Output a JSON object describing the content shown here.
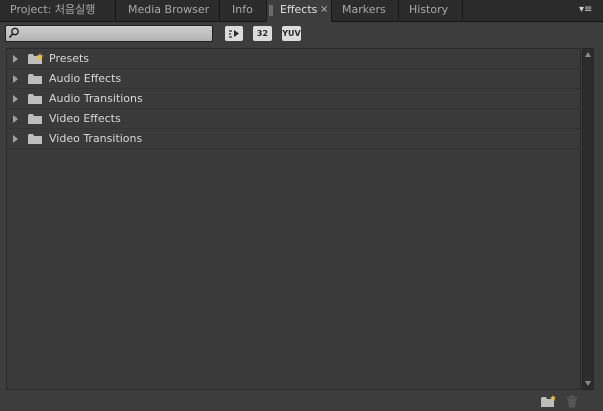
{
  "colors": {
    "panel_bg": "#3d3d3d",
    "tab_bar_bg": "#2b2b2b",
    "folder": "#bdbdbd",
    "preset_star": "#f2c21b"
  },
  "tabs": [
    {
      "label": "Project: 처음실행",
      "active": false
    },
    {
      "label": "Media Browser",
      "active": false
    },
    {
      "label": "Info",
      "active": false
    },
    {
      "label": "Effects",
      "active": true,
      "close": "×"
    },
    {
      "label": "Markers",
      "active": false
    },
    {
      "label": "History",
      "active": false
    }
  ],
  "panel_menu_icon": "▾≡",
  "search": {
    "value": "",
    "placeholder": ""
  },
  "toolbar": {
    "accelerated_effects_icon": "accelerated-effects-icon",
    "bit32_label": "32",
    "yuv_label": "YUV"
  },
  "tree": {
    "items": [
      {
        "label": "Presets",
        "icon": "preset-folder-icon"
      },
      {
        "label": "Audio Effects",
        "icon": "folder-icon"
      },
      {
        "label": "Audio Transitions",
        "icon": "folder-icon"
      },
      {
        "label": "Video Effects",
        "icon": "folder-icon"
      },
      {
        "label": "Video Transitions",
        "icon": "folder-icon"
      }
    ]
  },
  "footer": {
    "new_bin_icon": "new-custom-bin-icon",
    "delete_icon": "trash-icon"
  }
}
